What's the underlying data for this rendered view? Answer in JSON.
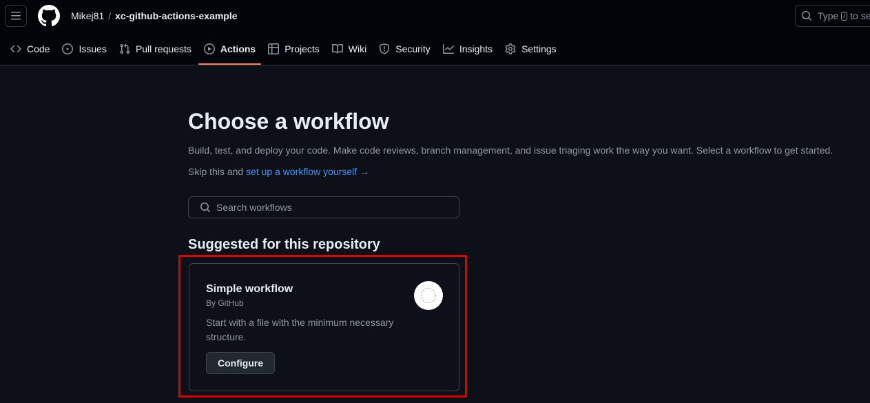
{
  "header": {
    "owner": "Mikej81",
    "separator": "/",
    "repo": "xc-github-actions-example",
    "search": {
      "prefix": "Type",
      "key": "/",
      "suffix": "to se"
    }
  },
  "nav": {
    "items": [
      {
        "label": "Code",
        "icon": "code-icon"
      },
      {
        "label": "Issues",
        "icon": "issue-opened-icon"
      },
      {
        "label": "Pull requests",
        "icon": "git-pull-request-icon"
      },
      {
        "label": "Actions",
        "icon": "play-icon",
        "active": true
      },
      {
        "label": "Projects",
        "icon": "table-icon"
      },
      {
        "label": "Wiki",
        "icon": "book-icon"
      },
      {
        "label": "Security",
        "icon": "shield-icon"
      },
      {
        "label": "Insights",
        "icon": "graph-icon"
      },
      {
        "label": "Settings",
        "icon": "gear-icon"
      }
    ]
  },
  "main": {
    "title": "Choose a workflow",
    "description": "Build, test, and deploy your code. Make code reviews, branch management, and issue triaging work the way you want. Select a workflow to get started.",
    "skip_prefix": "Skip this and",
    "skip_link": "set up a workflow yourself",
    "skip_arrow": "→",
    "search_placeholder": "Search workflows",
    "suggested_heading": "Suggested for this repository",
    "card": {
      "title": "Simple workflow",
      "author": "By GitHub",
      "description": "Start with a file with the minimum necessary structure.",
      "button": "Configure"
    }
  },
  "colors": {
    "background": "#0d1117",
    "header_background": "#010409",
    "link": "#4493f8",
    "active_tab_underline": "#f78166",
    "highlight_box": "#e00000"
  }
}
